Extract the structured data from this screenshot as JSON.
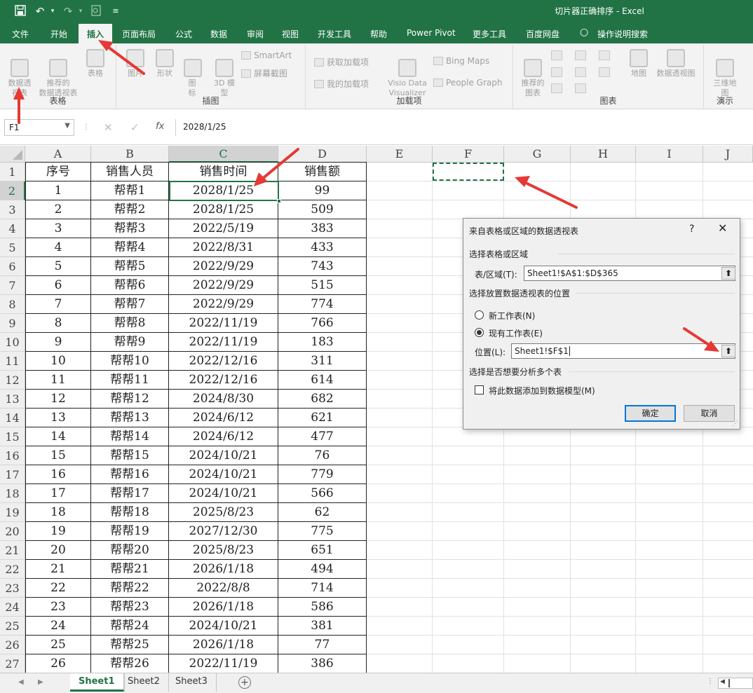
{
  "window": {
    "title": "切片器正确排序 - Excel"
  },
  "quick_access": {
    "save_icon": "save-icon",
    "undo_icon": "undo-icon",
    "redo_icon": "redo-icon",
    "print_preview_icon": "print-preview-icon",
    "customize_icon": "customize-icon"
  },
  "tabs": [
    {
      "label": "文件"
    },
    {
      "label": "开始"
    },
    {
      "label": "插入"
    },
    {
      "label": "页面布局"
    },
    {
      "label": "公式"
    },
    {
      "label": "数据"
    },
    {
      "label": "审阅"
    },
    {
      "label": "视图"
    },
    {
      "label": "开发工具"
    },
    {
      "label": "帮助"
    },
    {
      "label": "Power Pivot"
    },
    {
      "label": "更多工具"
    },
    {
      "label": "百度网盘"
    },
    {
      "label": "操作说明搜索"
    }
  ],
  "ribbon": {
    "tables": {
      "label": "表格",
      "pivot": "数据透\n视表",
      "recommended_pivot": "推荐的\n数据透视表",
      "table": "表格"
    },
    "illustrations": {
      "label": "插图",
      "pictures": "图片",
      "shapes": "形状",
      "icons": "图\n标",
      "models_3d": "3D 模\n型",
      "smartart": "SmartArt",
      "screenshot": "屏幕截图"
    },
    "addins": {
      "label": "加载项",
      "get_addins": "获取加载项",
      "my_addins": "我的加载项",
      "visio": "Visio Data\nVisualizer",
      "bing_maps": "Bing Maps",
      "people_graph": "People Graph"
    },
    "charts": {
      "label": "图表",
      "recommended_charts": "推荐的\n图表",
      "maps": "地图",
      "pivot_chart": "数据透视图"
    },
    "tours": {
      "label": "演示",
      "map_3d": "三维地\n图"
    }
  },
  "formula_bar": {
    "name_box": "F1",
    "cancel": "✕",
    "enter": "✓",
    "fx": "fx",
    "value": "2028/1/25"
  },
  "columns": [
    "A",
    "B",
    "C",
    "D",
    "E",
    "F",
    "G",
    "H",
    "I",
    "J"
  ],
  "rows": [
    "1",
    "2",
    "3",
    "4",
    "5",
    "6",
    "7",
    "8",
    "9",
    "10",
    "11",
    "12",
    "13",
    "14",
    "15",
    "16",
    "17",
    "18",
    "19",
    "20",
    "21",
    "22",
    "23",
    "24",
    "25",
    "26",
    "27"
  ],
  "table": {
    "headers": [
      "序号",
      "销售人员",
      "销售时间",
      "销售额"
    ],
    "rows": [
      [
        "1",
        "帮帮1",
        "2028/1/25",
        "99"
      ],
      [
        "2",
        "帮帮2",
        "2028/1/25",
        "509"
      ],
      [
        "3",
        "帮帮3",
        "2022/5/19",
        "383"
      ],
      [
        "4",
        "帮帮4",
        "2022/8/31",
        "433"
      ],
      [
        "5",
        "帮帮5",
        "2022/9/29",
        "743"
      ],
      [
        "6",
        "帮帮6",
        "2022/9/29",
        "515"
      ],
      [
        "7",
        "帮帮7",
        "2022/9/29",
        "774"
      ],
      [
        "8",
        "帮帮8",
        "2022/11/19",
        "766"
      ],
      [
        "9",
        "帮帮9",
        "2022/11/19",
        "183"
      ],
      [
        "10",
        "帮帮10",
        "2022/12/16",
        "311"
      ],
      [
        "11",
        "帮帮11",
        "2022/12/16",
        "614"
      ],
      [
        "12",
        "帮帮12",
        "2024/8/30",
        "682"
      ],
      [
        "13",
        "帮帮13",
        "2024/6/12",
        "621"
      ],
      [
        "14",
        "帮帮14",
        "2024/6/12",
        "477"
      ],
      [
        "15",
        "帮帮15",
        "2024/10/21",
        "76"
      ],
      [
        "16",
        "帮帮16",
        "2024/10/21",
        "779"
      ],
      [
        "17",
        "帮帮17",
        "2024/10/21",
        "566"
      ],
      [
        "18",
        "帮帮18",
        "2025/8/23",
        "62"
      ],
      [
        "19",
        "帮帮19",
        "2027/12/30",
        "775"
      ],
      [
        "20",
        "帮帮20",
        "2025/8/23",
        "651"
      ],
      [
        "21",
        "帮帮21",
        "2026/1/18",
        "494"
      ],
      [
        "22",
        "帮帮22",
        "2022/8/8",
        "714"
      ],
      [
        "23",
        "帮帮23",
        "2026/1/18",
        "586"
      ],
      [
        "24",
        "帮帮24",
        "2024/10/21",
        "381"
      ],
      [
        "25",
        "帮帮25",
        "2026/1/18",
        "77"
      ],
      [
        "26",
        "帮帮26",
        "2022/11/19",
        "386"
      ]
    ]
  },
  "dialog": {
    "title": "来自表格或区域的数据透视表",
    "help": "?",
    "close": "✕",
    "section_source": "选择表格或区域",
    "range_label": "表/区域(T):",
    "range_value": "Sheet1!$A$1:$D$365",
    "section_location": "选择放置数据透视表的位置",
    "new_sheet": "新工作表(N)",
    "existing_sheet": "现有工作表(E)",
    "location_label": "位置(L):",
    "location_value": "Sheet1!$F$1",
    "section_multi": "选择是否想要分析多个表",
    "add_to_model": "将此数据添加到数据模型(M)",
    "ok": "确定",
    "cancel": "取消"
  },
  "sheets": [
    "Sheet1",
    "Sheet2",
    "Sheet3"
  ],
  "colors": {
    "excel_green": "#217346",
    "annotation_red": "#e53935"
  }
}
